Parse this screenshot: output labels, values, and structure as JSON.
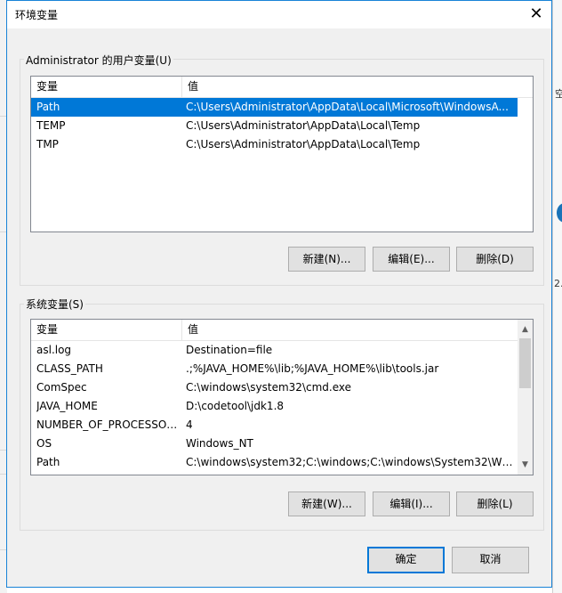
{
  "window": {
    "title": "环境变量",
    "close_glyph": "✕"
  },
  "user_vars": {
    "group_title": "Administrator 的用户变量(U)",
    "columns": [
      "变量",
      "值"
    ],
    "rows": [
      {
        "name": "Path",
        "value": "C:\\Users\\Administrator\\AppData\\Local\\Microsoft\\WindowsA...",
        "selected": true
      },
      {
        "name": "TEMP",
        "value": "C:\\Users\\Administrator\\AppData\\Local\\Temp",
        "selected": false
      },
      {
        "name": "TMP",
        "value": "C:\\Users\\Administrator\\AppData\\Local\\Temp",
        "selected": false
      }
    ],
    "buttons": {
      "new": "新建(N)...",
      "edit": "编辑(E)...",
      "delete": "删除(D)"
    }
  },
  "system_vars": {
    "group_title": "系统变量(S)",
    "columns": [
      "变量",
      "值"
    ],
    "rows": [
      {
        "name": "asl.log",
        "value": "Destination=file"
      },
      {
        "name": "CLASS_PATH",
        "value": ".;%JAVA_HOME%\\lib;%JAVA_HOME%\\lib\\tools.jar"
      },
      {
        "name": "ComSpec",
        "value": "C:\\windows\\system32\\cmd.exe"
      },
      {
        "name": "JAVA_HOME",
        "value": "D:\\codetool\\jdk1.8"
      },
      {
        "name": "NUMBER_OF_PROCESSORS",
        "value": "4"
      },
      {
        "name": "OS",
        "value": "Windows_NT"
      },
      {
        "name": "Path",
        "value": "C:\\windows\\system32;C:\\windows;C:\\windows\\System32\\Wbe..."
      }
    ],
    "buttons": {
      "new": "新建(W)...",
      "edit": "编辑(I)...",
      "delete": "删除(L)"
    }
  },
  "footer": {
    "ok": "确定",
    "cancel": "取消"
  },
  "background": {
    "fragments": [
      "空",
      "2."
    ]
  },
  "colors": {
    "accent": "#0078d7",
    "selection": "#0078d7",
    "dialog_bg": "#f0f0f0"
  }
}
